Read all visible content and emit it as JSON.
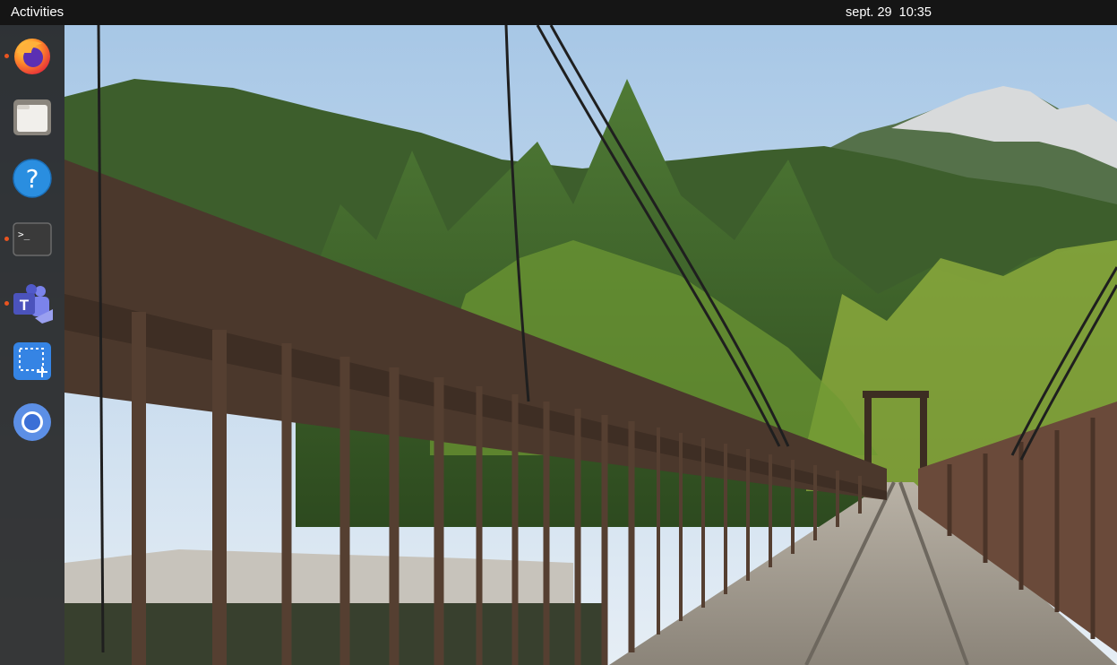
{
  "topbar": {
    "activities_label": "Activities",
    "clock": "sept. 29  10:35"
  },
  "dock": {
    "items": [
      {
        "name": "Firefox",
        "icon": "firefox-icon",
        "running": true
      },
      {
        "name": "Files",
        "icon": "files-icon",
        "running": false
      },
      {
        "name": "Help",
        "icon": "help-icon",
        "running": false
      },
      {
        "name": "Terminal",
        "icon": "terminal-icon",
        "running": true
      },
      {
        "name": "Microsoft Teams",
        "icon": "teams-icon",
        "running": true
      },
      {
        "name": "Screenshot",
        "icon": "screenshot-icon",
        "running": false
      },
      {
        "name": "Chromium",
        "icon": "chromium-icon",
        "running": false
      }
    ],
    "terminal_prompt": ">_",
    "help_glyph": "?",
    "teams_letter": "T"
  },
  "colors": {
    "topbar_bg": "#151515",
    "dock_bg": "#1e1e1e",
    "running_dot": "#e95420",
    "sky": "#a9c9e8",
    "forest": "#3b6a2a",
    "bridge_wood": "#4e3a2c"
  }
}
